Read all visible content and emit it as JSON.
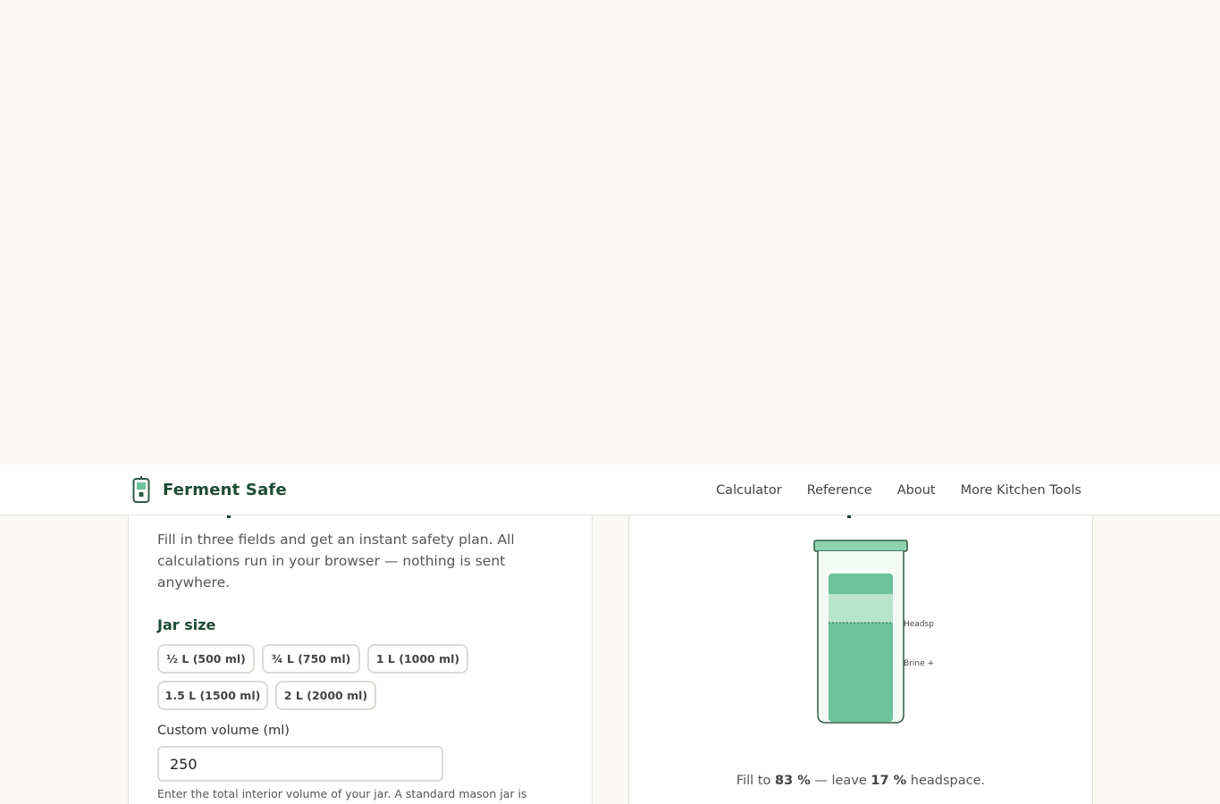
{
  "header": {
    "brand": "Ferment Safe",
    "nav": [
      "Calculator",
      "Reference",
      "About",
      "More Kitchen Tools"
    ]
  },
  "calculator": {
    "intro": "Fill in three fields and get an instant safety plan. All calculations run in your browser — nothing is sent anywhere.",
    "jar_size_label": "Jar size",
    "jar_options": [
      "½ L (500 ml)",
      "¾ L (750 ml)",
      "1 L (1000 ml)",
      "1.5 L (1500 ml)",
      "2 L (2000 ml)"
    ],
    "custom_volume_label": "Custom volume (ml)",
    "custom_volume_value": "250",
    "hint": "Enter the total interior volume of your jar. A standard mason jar is"
  },
  "jar_diagram": {
    "headspace_label": "Headsp",
    "brine_label": "Brine +",
    "fill_prefix": "Fill to",
    "fill_percent": "83 %",
    "fill_mid": "— leave",
    "headspace_percent": "17 %",
    "fill_suffix": "headspace.",
    "fill_fraction": 0.83,
    "colors": {
      "brine": "#6cc39a",
      "headspace": "#b8e4cc",
      "lid": "#8fd3b0",
      "outline": "#2f5b46"
    }
  }
}
